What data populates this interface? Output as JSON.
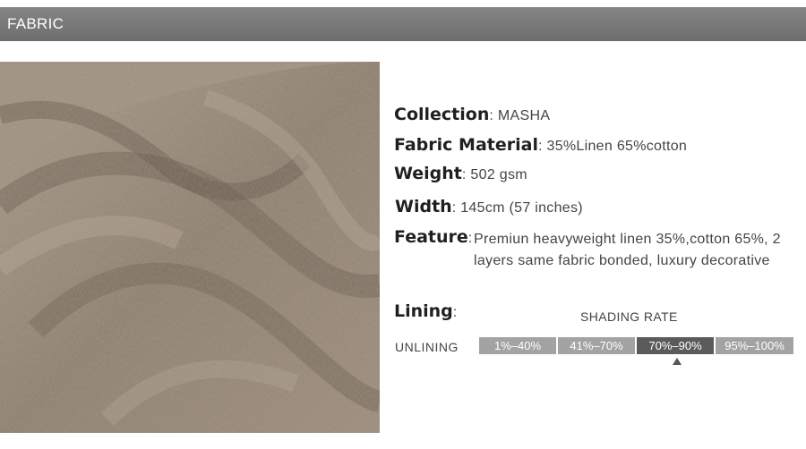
{
  "header": {
    "title": "FABRIC"
  },
  "image": {
    "icon": "fabric-texture-photo"
  },
  "specs": {
    "collection": {
      "label": "Collection",
      "sep": ":",
      "value": "MASHA"
    },
    "material": {
      "label": "Fabric Material",
      "sep": ":",
      "value": "35%Linen 65%cotton"
    },
    "weight": {
      "label": "Weight",
      "sep": ":",
      "value": "502 gsm"
    },
    "width": {
      "label": "Width",
      "sep": ":",
      "value": "145cm (57 inches)"
    },
    "feature": {
      "label": "Feature",
      "sep": ":",
      "value": "Premiun heavyweight linen 35%,cotton 65%, 2 layers same fabric bonded, luxury decorative"
    },
    "lining": {
      "label": "Lining",
      "sep": ":"
    }
  },
  "shading": {
    "title": "SHADING RATE",
    "unlining_label": "UNLINING",
    "options": [
      "1%–40%",
      "41%–70%",
      "70%–90%",
      "95%–100%"
    ],
    "selected": "70%–90%"
  },
  "colors": {
    "header_bg": "#7a7a7a",
    "cell": "#a3a3a3",
    "cell_active": "#5b5b5b"
  }
}
